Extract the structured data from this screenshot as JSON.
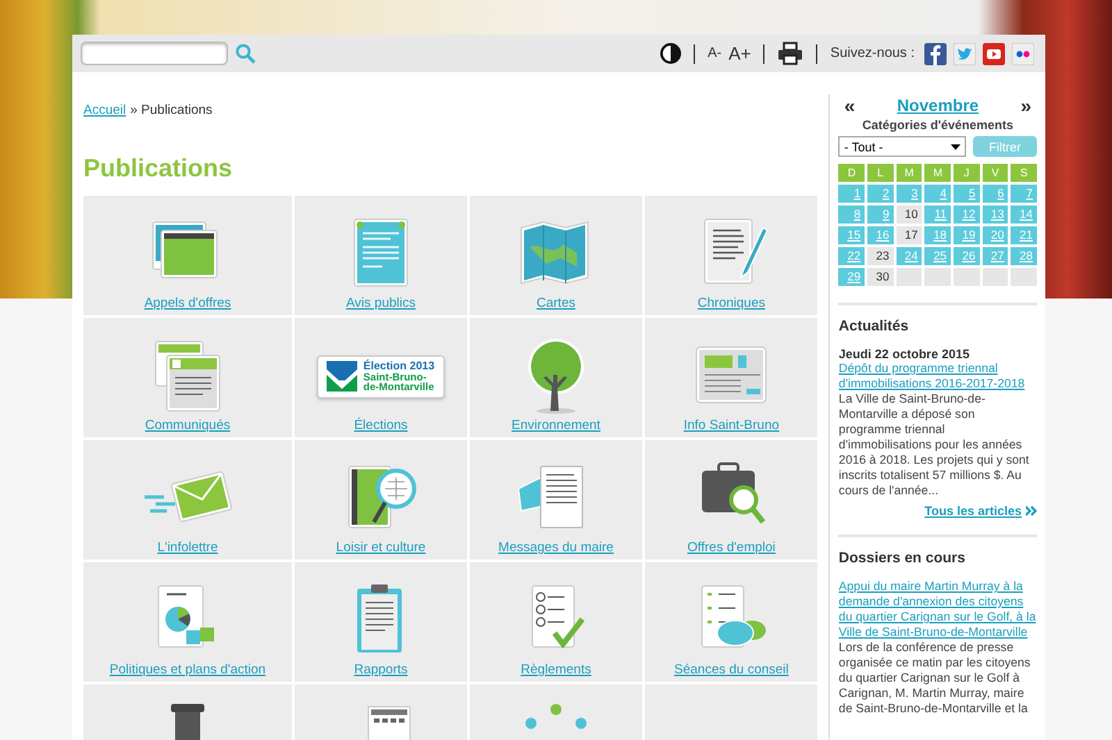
{
  "toolbar": {
    "text_size_buttons": [
      "A-",
      "A+"
    ],
    "follow_label": "Suivez-nous :"
  },
  "breadcrumb": {
    "home_link": "Accueil",
    "current": "» Publications"
  },
  "page_title": "Publications",
  "publications": [
    {
      "label": "Appels d'offres"
    },
    {
      "label": "Avis publics"
    },
    {
      "label": "Cartes"
    },
    {
      "label": "Chroniques"
    },
    {
      "label": "Communiqués"
    },
    {
      "label": "Élections",
      "logo_lines": [
        "Élection 2013",
        "Saint-Bruno-",
        "de-Montarville"
      ]
    },
    {
      "label": "Environnement"
    },
    {
      "label": "Info Saint-Bruno"
    },
    {
      "label": "L'infolettre"
    },
    {
      "label": "Loisir et culture"
    },
    {
      "label": "Messages du maire"
    },
    {
      "label": "Offres d'emploi"
    },
    {
      "label": "Politiques et plans d'action"
    },
    {
      "label": "Rapports"
    },
    {
      "label": "Règlements"
    },
    {
      "label": "Séances du conseil"
    }
  ],
  "calendar": {
    "prev": "«",
    "month": "Novembre",
    "next": "»",
    "categories_label": "Catégories d'événements",
    "category_select": "- Tout -",
    "filter_button": "Filtrer",
    "weekdays": [
      "D",
      "L",
      "M",
      "M",
      "J",
      "V",
      "S"
    ],
    "weeks": [
      [
        {
          "day": "1",
          "has_events": true
        },
        {
          "day": "2",
          "has_events": true
        },
        {
          "day": "3",
          "has_events": true
        },
        {
          "day": "4",
          "has_events": true
        },
        {
          "day": "5",
          "has_events": true
        },
        {
          "day": "6",
          "has_events": true
        },
        {
          "day": "7",
          "has_events": true
        }
      ],
      [
        {
          "day": "8",
          "has_events": true
        },
        {
          "day": "9",
          "has_events": true
        },
        {
          "day": "10",
          "has_events": false
        },
        {
          "day": "11",
          "has_events": true
        },
        {
          "day": "12",
          "has_events": true
        },
        {
          "day": "13",
          "has_events": true
        },
        {
          "day": "14",
          "has_events": true
        }
      ],
      [
        {
          "day": "15",
          "has_events": true
        },
        {
          "day": "16",
          "has_events": true
        },
        {
          "day": "17",
          "has_events": false
        },
        {
          "day": "18",
          "has_events": true
        },
        {
          "day": "19",
          "has_events": true
        },
        {
          "day": "20",
          "has_events": true
        },
        {
          "day": "21",
          "has_events": true
        }
      ],
      [
        {
          "day": "22",
          "has_events": true
        },
        {
          "day": "23",
          "has_events": false
        },
        {
          "day": "24",
          "has_events": true
        },
        {
          "day": "25",
          "has_events": true
        },
        {
          "day": "26",
          "has_events": true
        },
        {
          "day": "27",
          "has_events": true
        },
        {
          "day": "28",
          "has_events": true
        }
      ],
      [
        {
          "day": "29",
          "has_events": true
        },
        {
          "day": "30",
          "has_events": false
        }
      ]
    ]
  },
  "news": {
    "heading": "Actualités",
    "date": "Jeudi 22 octobre 2015",
    "link": "Dépôt du programme triennal d'immobilisations 2016-2017-2018",
    "summary": "La Ville de Saint-Bruno-de-Montarville a déposé son programme triennal d'immobilisations pour les années 2016 à 2018. Les projets qui y sont inscrits totalisent 57 millions $. Au cours de l'année...",
    "more_link": "Tous les articles"
  },
  "files": {
    "heading": "Dossiers en cours",
    "link": "Appui du maire Martin Murray à la demande d'annexion des citoyens du quartier Carignan sur le Golf, à la Ville de Saint-Bruno-de-Montarville",
    "summary": "Lors de la conférence de presse organisée ce matin par les citoyens du quartier Carignan sur le Golf à Carignan, M. Martin Murray, maire de Saint-Bruno-de-Montarville et la"
  }
}
